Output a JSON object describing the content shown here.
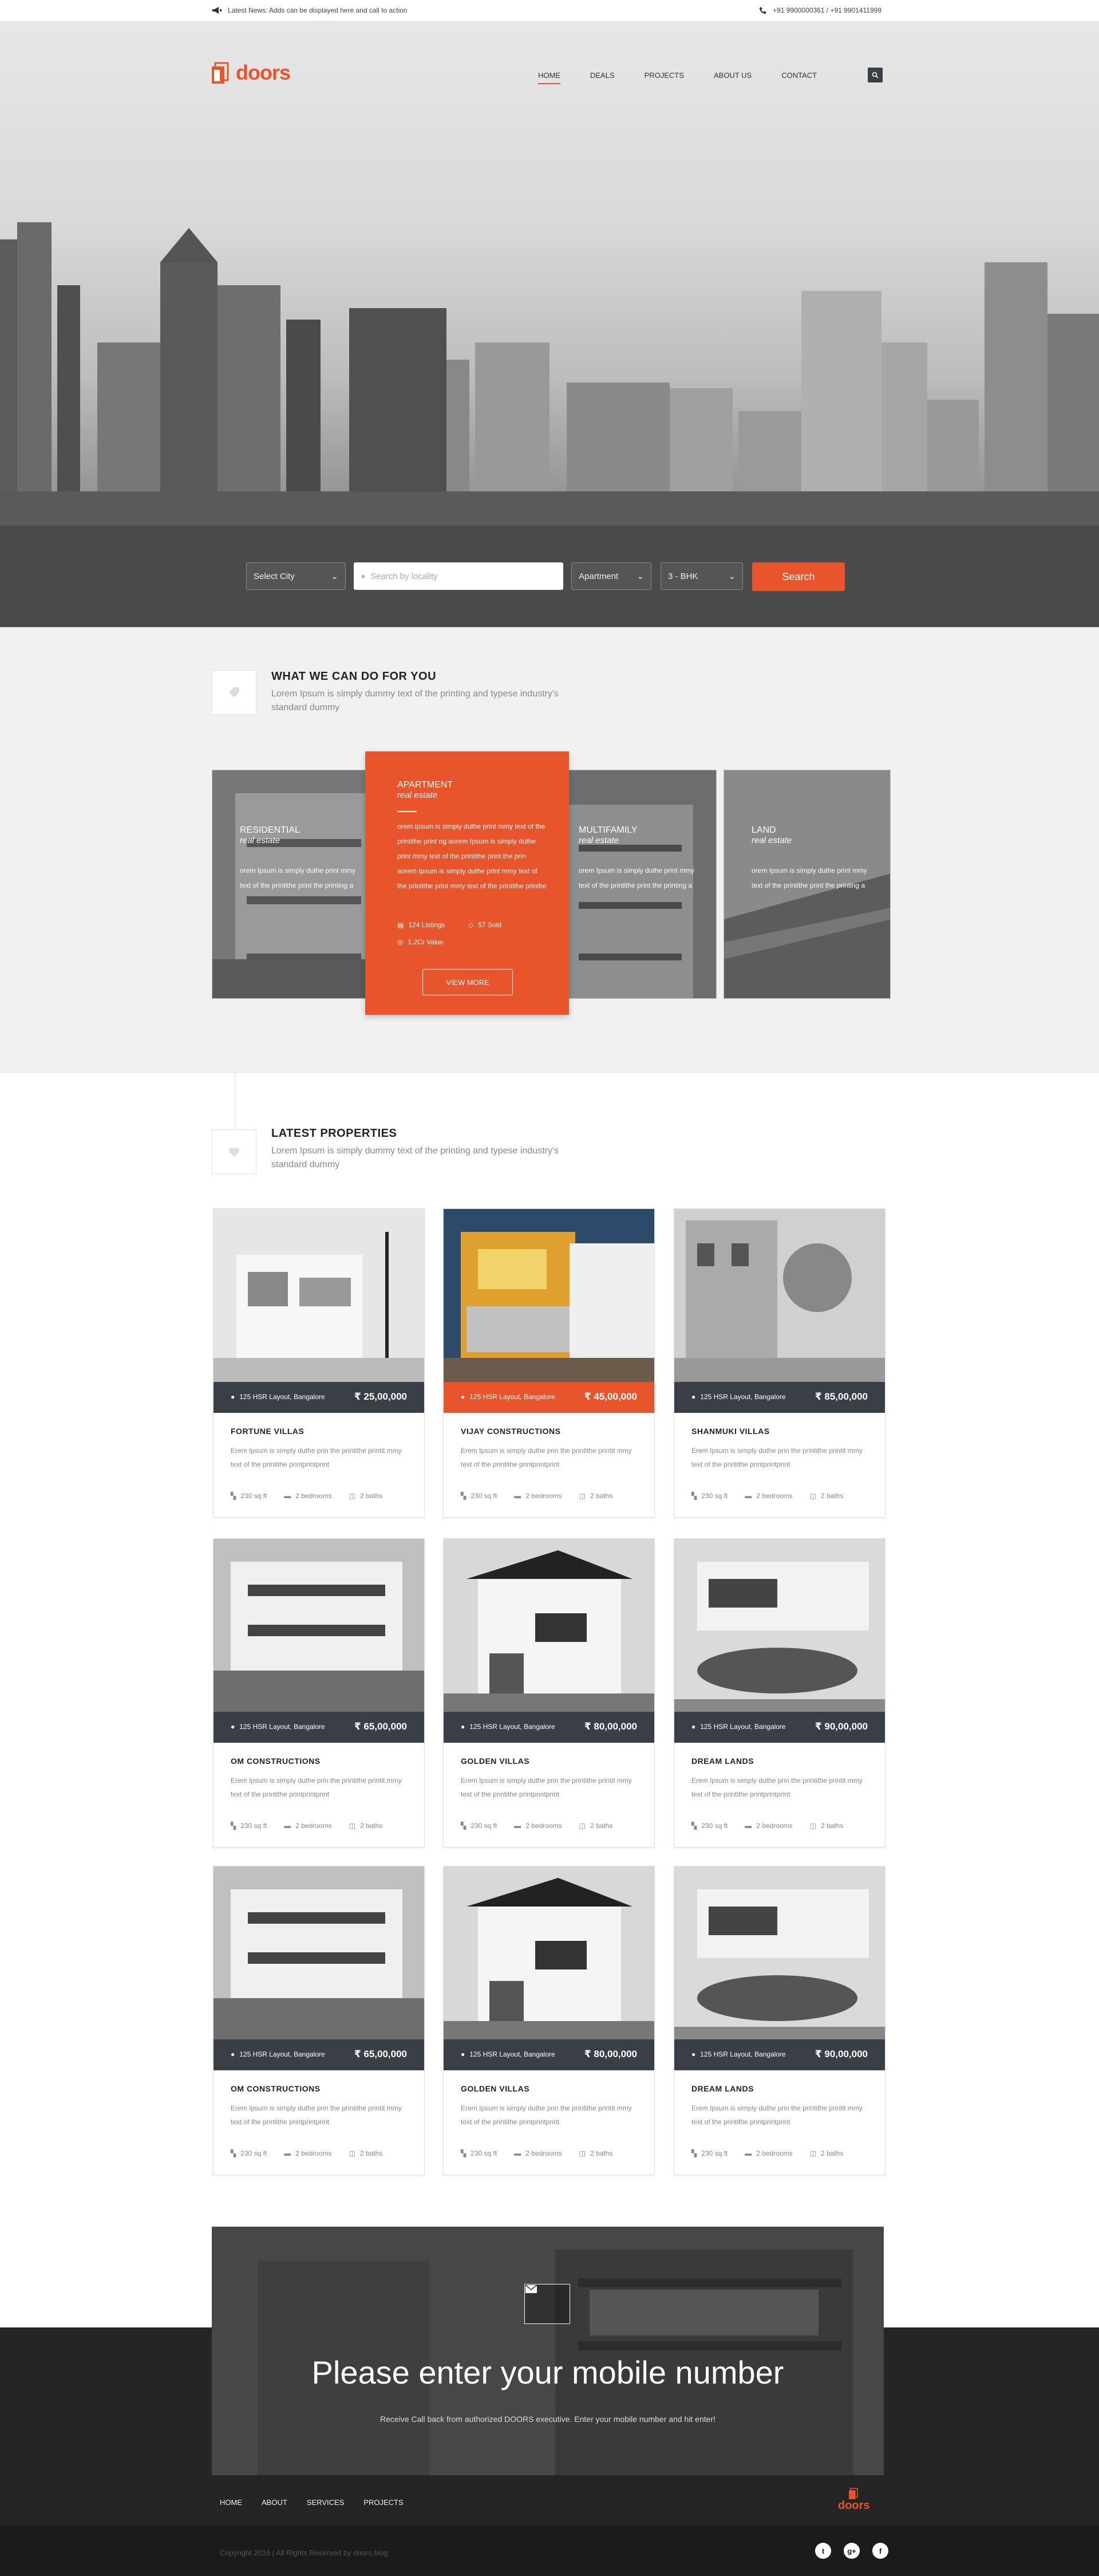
{
  "topbar": {
    "news": "Latest News: Adds can be displayed here and call to action",
    "phone": "+91 9900000361 / +91 9901411999"
  },
  "brand": {
    "name": "doors",
    "color": "#e8542b"
  },
  "nav": {
    "items": [
      {
        "label": "HOME",
        "active": true
      },
      {
        "label": "DEALS"
      },
      {
        "label": "PROJECTS"
      },
      {
        "label": "ABOUT US"
      },
      {
        "label": "CONTACT"
      }
    ]
  },
  "search": {
    "city": "Select City",
    "locality_placeholder": "Search by locality",
    "type": "Apartment",
    "bhk": "3 - BHK",
    "button": "Search"
  },
  "services": {
    "title": "WHAT WE CAN DO FOR YOU",
    "subtitle": "Lorem Ipsum is simply dummy text of the printing and typese industry's standard dummy",
    "cards": [
      {
        "title": "RESIDENTIAL",
        "sub": "real estate",
        "text": "orem Ipsum is simply duthe print mmy text of the printithe print the printing a"
      },
      {
        "title": "MULTIFAMILY",
        "sub": "real estate",
        "text": "orem Ipsum is simply duthe print mmy text of the printithe print the printing a"
      },
      {
        "title": "LAND",
        "sub": "real estate",
        "text": "orem Ipsum is simply duthe print mmy text of the printithe print the printing a"
      }
    ],
    "featured": {
      "title": "APARTMENT",
      "sub": "real estate",
      "text": "orem Ipsum is simply duthe print mmy text of the printithe print ng aorem Ipsum is simply duthe print mmy text of the printithe print the prin aorem Ipsum is simply duthe print mmy text of the printithe print mmy text of the printithe printhe",
      "listings": "124 Listings",
      "sold": "57 Sold",
      "value": "1.2Cr Value",
      "button": "VIEW MORE"
    }
  },
  "properties": {
    "title": "LATEST PROPERTIES",
    "subtitle": "Lorem Ipsum is simply dummy text of the printing and typese industry's standard dummy",
    "desc": "Erem Ipsum is simply duthe prin the printithe printit mmy text of the printithe printprintprint",
    "area": "230 sq ft",
    "beds": "2 bedrooms",
    "baths": "2 baths",
    "items": [
      {
        "name": "FORTUNE VILLAS",
        "addr": "125 HSR Layout, Bangalore",
        "price": "₹ 25,00,000"
      },
      {
        "name": "VIJAY CONSTRUCTIONS",
        "addr": "125 HSR Layout, Bangalore",
        "price": "₹ 45,00,000",
        "highlight": true
      },
      {
        "name": "SHANMUKI VILLAS",
        "addr": "125 HSR Layout, Bangalore",
        "price": "₹ 85,00,000"
      },
      {
        "name": "OM CONSTRUCTIONS",
        "addr": "125 HSR Layout, Bangalore",
        "price": "₹ 65,00,000"
      },
      {
        "name": "GOLDEN VILLAS",
        "addr": "125 HSR Layout, Bangalore",
        "price": "₹ 80,00,000"
      },
      {
        "name": "DREAM LANDS",
        "addr": "125 HSR Layout, Bangalore",
        "price": "₹ 90,00,000"
      },
      {
        "name": "OM CONSTRUCTIONS",
        "addr": "125 HSR Layout, Bangalore",
        "price": "₹ 65,00,000"
      },
      {
        "name": "GOLDEN VILLAS",
        "addr": "125 HSR Layout, Bangalore",
        "price": "₹ 80,00,000"
      },
      {
        "name": "DREAM LANDS",
        "addr": "125 HSR Layout, Bangalore",
        "price": "₹ 90,00,000"
      }
    ]
  },
  "newsletter": {
    "title": "Please enter your mobile number",
    "subtitle": "Receive Call back from authorized DOORS executive. Enter your mobile number and hit enter!"
  },
  "footer": {
    "nav": [
      "HOME",
      "ABOUT",
      "SERVICES",
      "PROJECTS"
    ],
    "logo": "doors",
    "copyright": "Copyright 2016 | All Rights Reserved by doors.blog",
    "social": [
      "t",
      "g+",
      "f"
    ]
  }
}
